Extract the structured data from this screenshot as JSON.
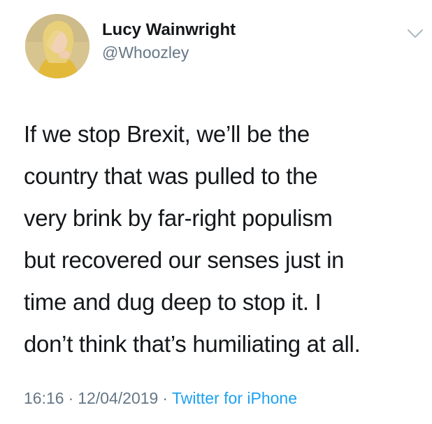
{
  "user": {
    "display_name": "Lucy Wainwright",
    "handle": "@Whoozley"
  },
  "tweet": {
    "lines": [
      "If we stop Brexit, we’ll be the",
      "country that was pulled to the",
      "very brink by far-right populism",
      "but recovered our senses just in",
      "time and dug deep to stop it. I",
      "don’t think that’s humiliating at all."
    ]
  },
  "footer": {
    "time": "16:16",
    "separator": "·",
    "date": "12/04/2019",
    "source": "Twitter for iPhone"
  },
  "icons": {
    "caret": "chevron-down-icon"
  },
  "colors": {
    "text": "#14171a",
    "muted": "#657786",
    "link": "#1da1f2",
    "caret": "#aab8c2"
  }
}
